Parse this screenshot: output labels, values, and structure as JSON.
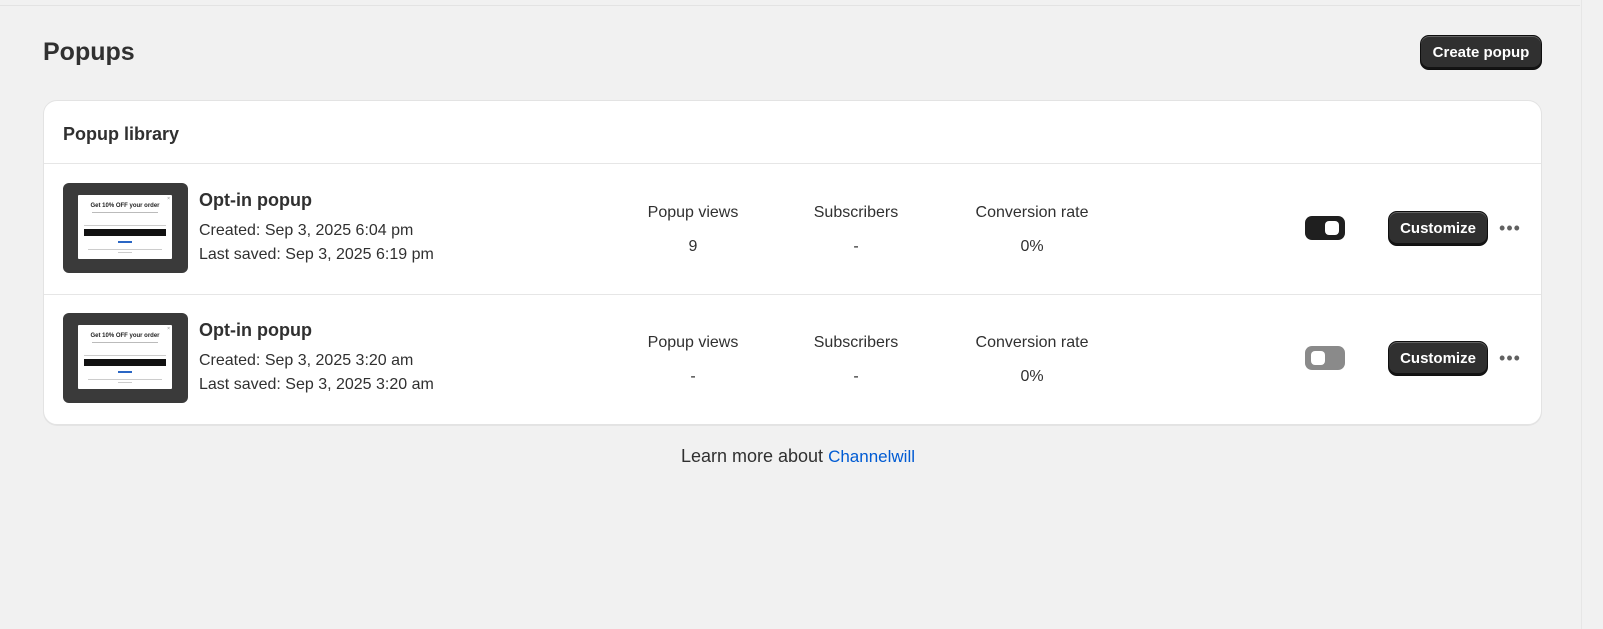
{
  "page": {
    "title": "Popups",
    "create_button": "Create popup"
  },
  "library": {
    "title": "Popup library",
    "rows": [
      {
        "name": "Opt-in popup",
        "created": "Created: Sep 3, 2025 6:04 pm",
        "last_saved": "Last saved: Sep 3, 2025 6:19 pm",
        "stats": [
          {
            "label": "Popup views",
            "value": "9"
          },
          {
            "label": "Subscribers",
            "value": "-"
          },
          {
            "label": "Conversion rate",
            "value": "0%"
          }
        ],
        "enabled": true,
        "customize_label": "Customize",
        "more_icon": "ellipsis-icon",
        "thumbnail": {
          "heading": "Get 10% OFF your order"
        }
      },
      {
        "name": "Opt-in popup",
        "created": "Created: Sep 3, 2025 3:20 am",
        "last_saved": "Last saved: Sep 3, 2025 3:20 am",
        "stats": [
          {
            "label": "Popup views",
            "value": "-"
          },
          {
            "label": "Subscribers",
            "value": "-"
          },
          {
            "label": "Conversion rate",
            "value": "0%"
          }
        ],
        "enabled": false,
        "customize_label": "Customize",
        "more_icon": "ellipsis-icon",
        "thumbnail": {
          "heading": "Get 10% OFF your order"
        }
      }
    ]
  },
  "footer": {
    "learn_text": "Learn more about",
    "link_text": "Channelwill",
    "link_color": "#005bd3"
  },
  "colors": {
    "toggle_on": "#1f1f1f",
    "toggle_off": "#8a8a8a",
    "button_dark": "#303030"
  }
}
